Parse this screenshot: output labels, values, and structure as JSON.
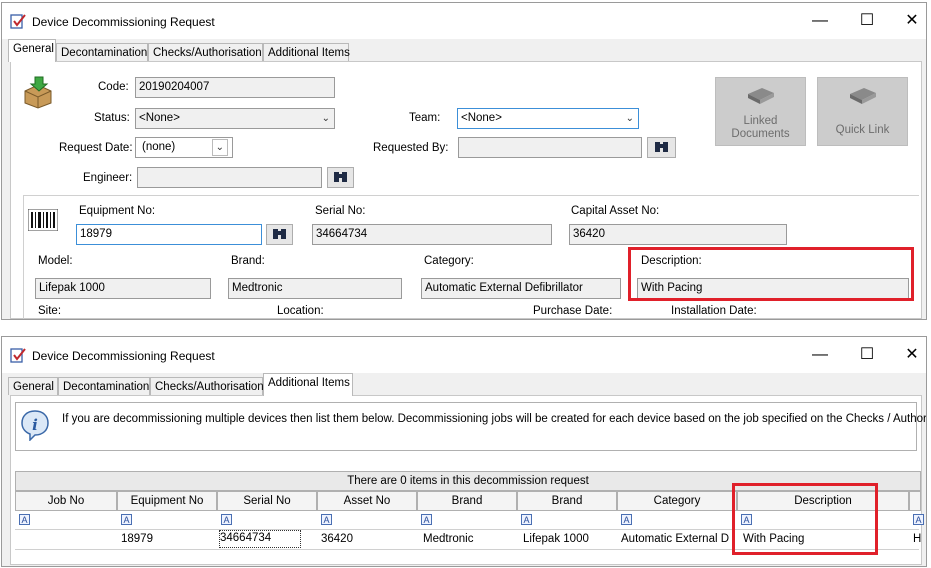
{
  "window1": {
    "title": "Device Decommissioning Request",
    "tabs": [
      "General",
      "Decontamination",
      "Checks/Authorisation",
      "Additional Items"
    ],
    "form": {
      "code_label": "Code:",
      "code_value": "20190204007",
      "status_label": "Status:",
      "status_value": "<None>",
      "team_label": "Team:",
      "team_value": "<None>",
      "request_date_label": "Request Date:",
      "request_date_value": "(none)",
      "requested_by_label": "Requested By:",
      "requested_by_value": "",
      "engineer_label": "Engineer:",
      "engineer_value": ""
    },
    "buttons": {
      "linked_documents": "Linked Documents",
      "quick_link": "Quick Link"
    },
    "equipment": {
      "equipment_no_label": "Equipment No:",
      "equipment_no_value": "18979",
      "serial_no_label": "Serial No:",
      "serial_no_value": "34664734",
      "capital_asset_no_label": "Capital Asset No:",
      "capital_asset_no_value": "36420",
      "model_label": "Model:",
      "model_value": "Lifepak 1000",
      "brand_label": "Brand:",
      "brand_value": "Medtronic",
      "category_label": "Category:",
      "category_value": "Automatic External Defibrillator",
      "description_label": "Description:",
      "description_value": "With Pacing",
      "site_label": "Site:",
      "location_label": "Location:",
      "purchase_date_label": "Purchase Date:",
      "installation_date_label": "Installation Date:"
    }
  },
  "window2": {
    "title": "Device Decommissioning Request",
    "tabs": [
      "General",
      "Decontamination",
      "Checks/Authorisation",
      "Additional Items"
    ],
    "info_text": "If you are decommissioning multiple devices then list them below. Decommissioning jobs will be created for each device based on the job specified on the Checks / Authorisation tab",
    "grid_caption": "There are 0 items in this decommission request",
    "columns": [
      "Job No",
      "Equipment No",
      "Serial No",
      "Asset No",
      "Brand",
      "Brand",
      "Category",
      "Description"
    ],
    "filter_glyph": "A",
    "row": [
      "",
      "18979",
      "34664734",
      "36420",
      "Medtronic",
      "Lifepak 1000",
      "Automatic External D",
      "With Pacing",
      "H"
    ]
  },
  "window_controls": {
    "minimize": "—",
    "maximize": "☐",
    "close": "✕"
  },
  "colors": {
    "highlight": "#e0202a",
    "focus": "#3c8fd8"
  }
}
